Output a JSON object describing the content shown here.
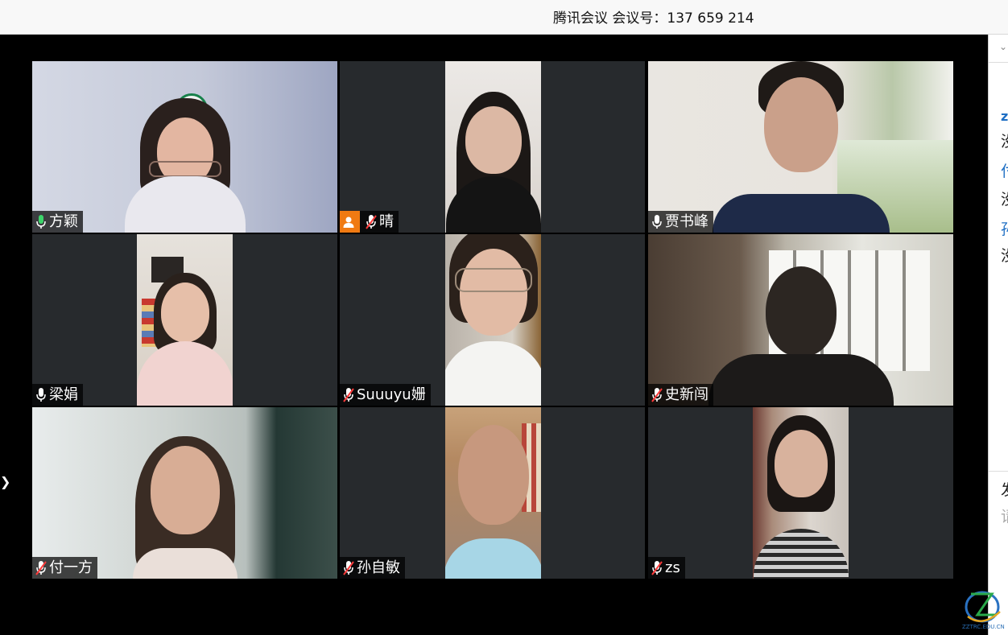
{
  "window": {
    "title": "腾讯会议 会议号：137 659 214"
  },
  "participants": [
    {
      "name": "方颖",
      "mic": "on-active",
      "host": false
    },
    {
      "name": "晴",
      "mic": "muted",
      "host": true
    },
    {
      "name": "贾书峰",
      "mic": "on",
      "host": false
    },
    {
      "name": "梁娟",
      "mic": "on",
      "host": false
    },
    {
      "name": "Suuuyu姗",
      "mic": "muted",
      "host": false
    },
    {
      "name": "史新闯",
      "mic": "muted",
      "host": false
    },
    {
      "name": "付一方",
      "mic": "muted",
      "host": false
    },
    {
      "name": "孙自敏",
      "mic": "muted",
      "host": false
    },
    {
      "name": "zs",
      "mic": "muted",
      "host": false
    }
  ],
  "side_panel": {
    "items": [
      "z",
      "没",
      "付",
      "没",
      "孙",
      "没"
    ],
    "input_label": "发",
    "input_placeholder": "请"
  },
  "watermark": {
    "text": "ZZTRC.EDU.CN"
  },
  "colors": {
    "active_speaker_border": "#2fbf6f",
    "mic_active": "#3cd46a",
    "muted_slash": "#ff3b3b",
    "host_badge": "#f07a12"
  }
}
